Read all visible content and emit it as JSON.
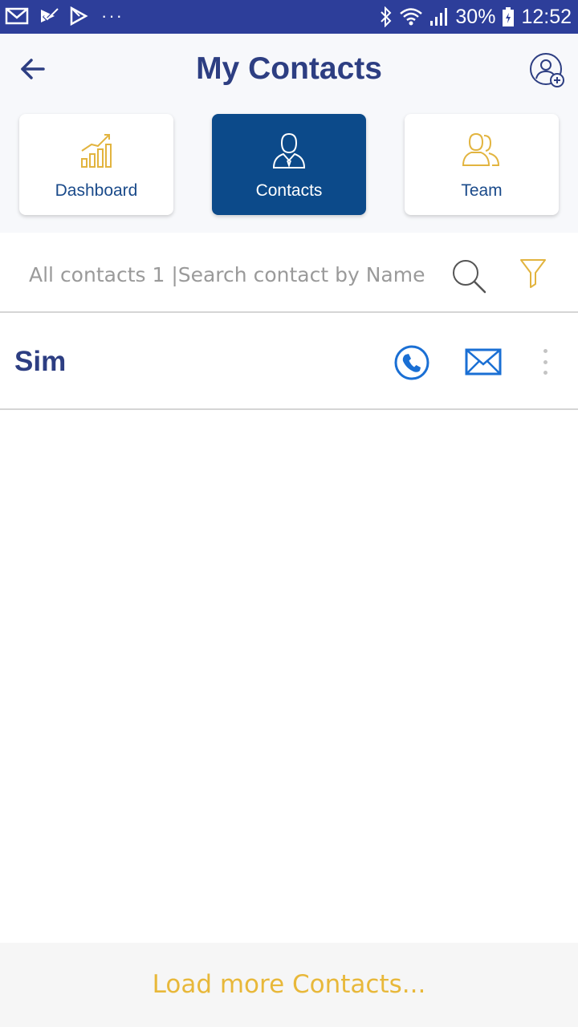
{
  "status_bar": {
    "battery": "30%",
    "time": "12:52",
    "notification_dots": "···"
  },
  "header": {
    "title": "My Contacts",
    "back_icon": "arrow-left-icon",
    "add_contact_icon": "add-user-icon"
  },
  "tabs": [
    {
      "label": "Dashboard",
      "icon": "growth-chart-icon",
      "active": false
    },
    {
      "label": "Contacts",
      "icon": "person-icon",
      "active": true
    },
    {
      "label": "Team",
      "icon": "team-icon",
      "active": false
    }
  ],
  "search": {
    "placeholder": "All contacts 1 |Search contact by Name",
    "value": ""
  },
  "contacts": [
    {
      "name": "Sim"
    }
  ],
  "footer": {
    "load_more_label": "Load more Contacts..."
  },
  "colors": {
    "status_bar": "#2d3e9a",
    "title": "#2d3e82",
    "active_tab": "#0c4a8a",
    "accent_gold": "#e8b83a",
    "icon_blue": "#1a6fd4"
  }
}
